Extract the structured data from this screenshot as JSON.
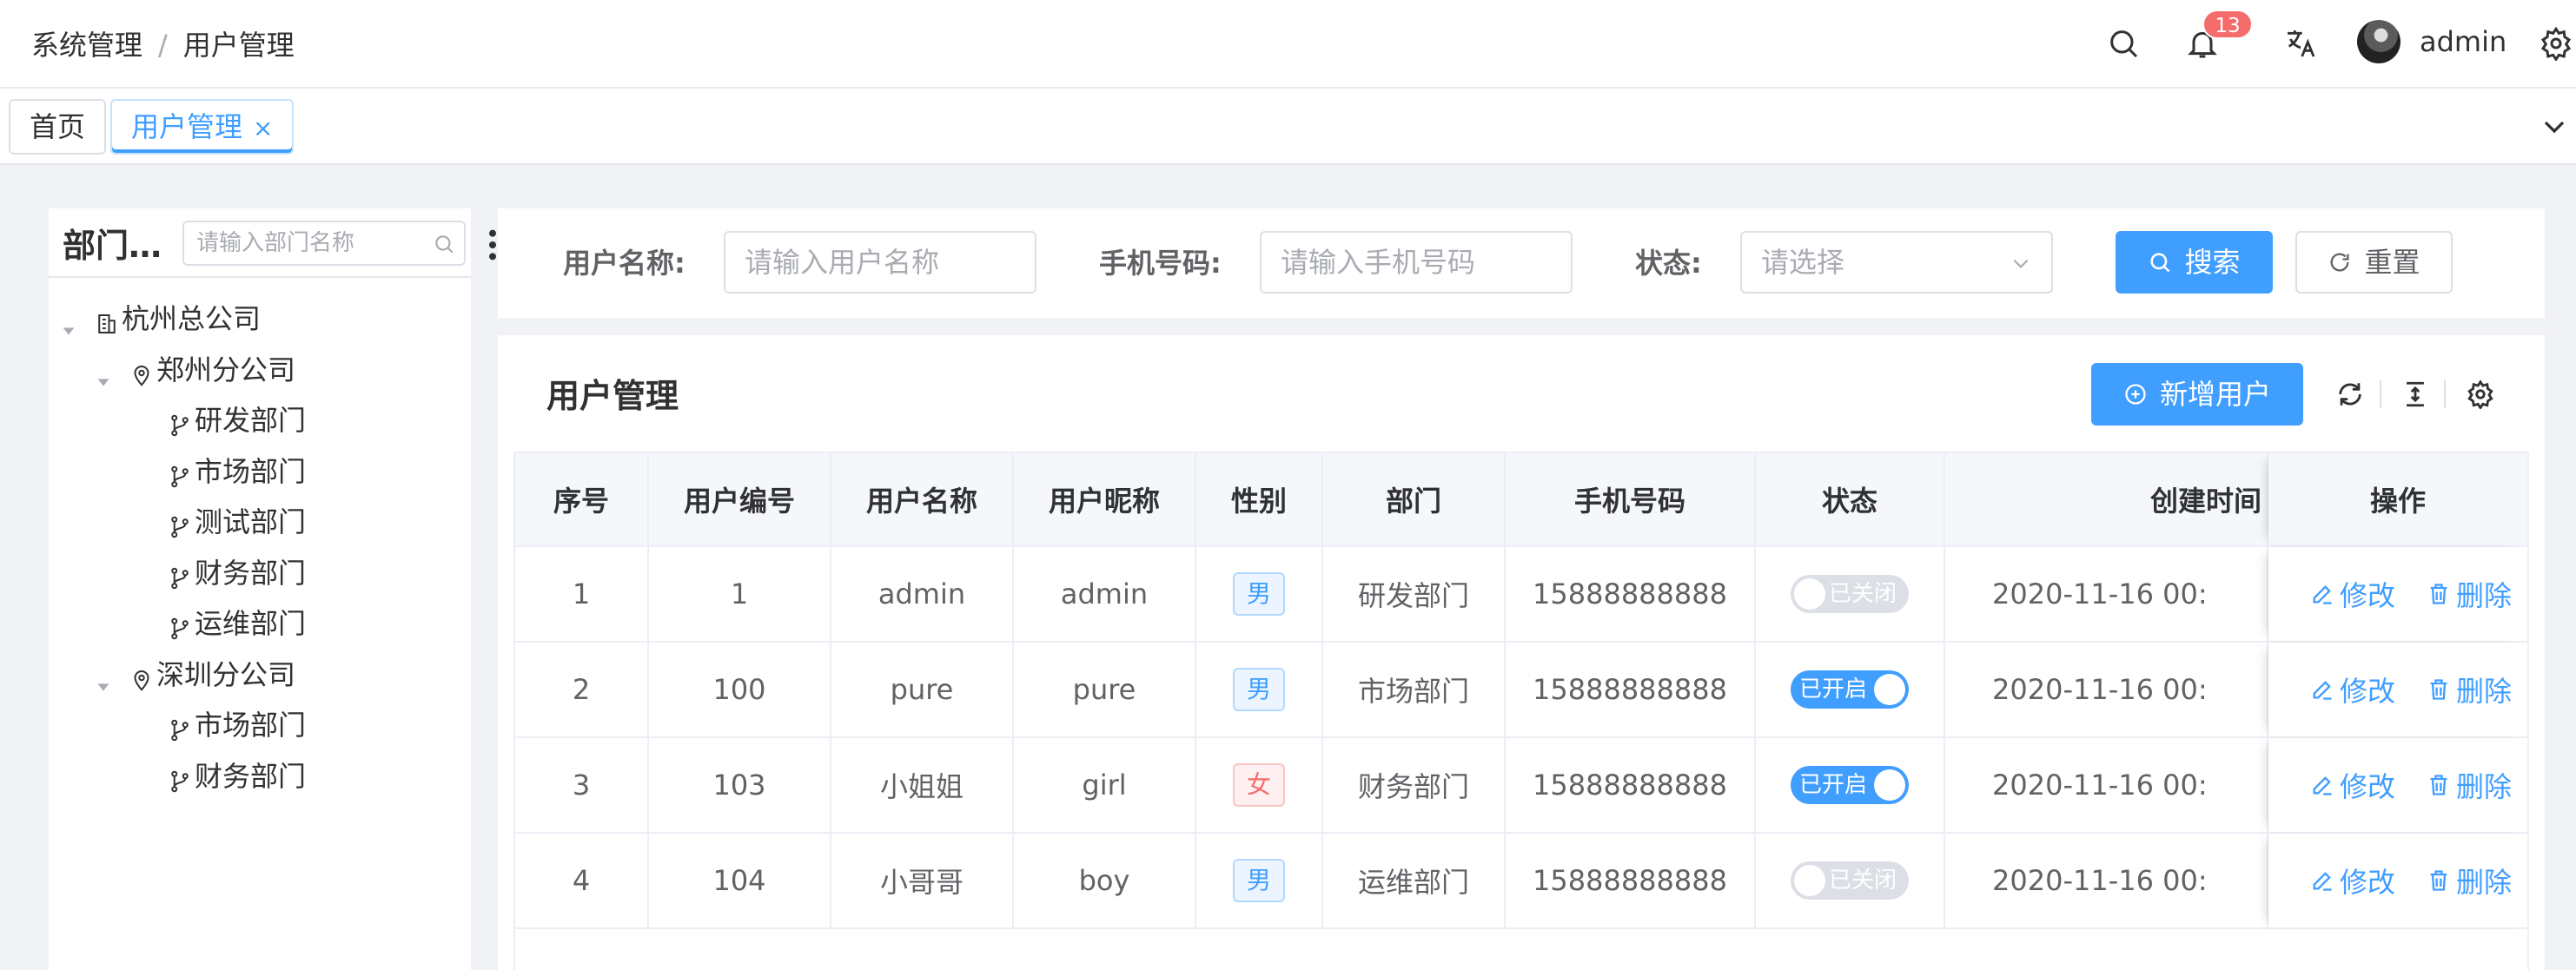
{
  "breadcrumb": {
    "items": [
      "系统管理",
      "用户管理"
    ],
    "separator": "/"
  },
  "header": {
    "notification_count": "13",
    "username": "admin"
  },
  "tabs": [
    {
      "label": "首页",
      "active": false
    },
    {
      "label": "用户管理",
      "active": true,
      "close": "×"
    }
  ],
  "dept": {
    "title": "部门…",
    "search_placeholder": "请输入部门名称",
    "tree": [
      {
        "label": "杭州总公司",
        "level": 0,
        "icon": "bank-icon",
        "expanded": true
      },
      {
        "label": "郑州分公司",
        "level": 1,
        "icon": "location-icon",
        "expanded": true
      },
      {
        "label": "研发部门",
        "level": 2,
        "icon": "branch-icon"
      },
      {
        "label": "市场部门",
        "level": 2,
        "icon": "branch-icon"
      },
      {
        "label": "测试部门",
        "level": 2,
        "icon": "branch-icon"
      },
      {
        "label": "财务部门",
        "level": 2,
        "icon": "branch-icon"
      },
      {
        "label": "运维部门",
        "level": 2,
        "icon": "branch-icon"
      },
      {
        "label": "深圳分公司",
        "level": 1,
        "icon": "location-icon",
        "expanded": true
      },
      {
        "label": "市场部门",
        "level": 2,
        "icon": "branch-icon"
      },
      {
        "label": "财务部门",
        "level": 2,
        "icon": "branch-icon"
      }
    ]
  },
  "search": {
    "username_label": "用户名称:",
    "username_placeholder": "请输入用户名称",
    "phone_label": "手机号码:",
    "phone_placeholder": "请输入手机号码",
    "status_label": "状态:",
    "status_placeholder": "请选择",
    "search_button": "搜索",
    "reset_button": "重置"
  },
  "table": {
    "title": "用户管理",
    "add_button": "新增用户",
    "columns": [
      "序号",
      "用户编号",
      "用户名称",
      "用户昵称",
      "性别",
      "部门",
      "手机号码",
      "状态",
      "创建时间",
      "操作"
    ],
    "rows": [
      {
        "index": "1",
        "id": "1",
        "username": "admin",
        "nickname": "admin",
        "gender": "男",
        "gender_type": "male",
        "dept": "研发部门",
        "phone": "15888888888",
        "status": "已关闭",
        "status_on": false,
        "created": "2020-11-16 00:",
        "edit": "修改",
        "delete": "删除"
      },
      {
        "index": "2",
        "id": "100",
        "username": "pure",
        "nickname": "pure",
        "gender": "男",
        "gender_type": "male",
        "dept": "市场部门",
        "phone": "15888888888",
        "status": "已开启",
        "status_on": true,
        "created": "2020-11-16 00:",
        "edit": "修改",
        "delete": "删除"
      },
      {
        "index": "3",
        "id": "103",
        "username": "小姐姐",
        "nickname": "girl",
        "gender": "女",
        "gender_type": "female",
        "dept": "财务部门",
        "phone": "15888888888",
        "status": "已开启",
        "status_on": true,
        "created": "2020-11-16 00:",
        "edit": "修改",
        "delete": "删除"
      },
      {
        "index": "4",
        "id": "104",
        "username": "小哥哥",
        "nickname": "boy",
        "gender": "男",
        "gender_type": "male",
        "dept": "运维部门",
        "phone": "15888888888",
        "status": "已关闭",
        "status_on": false,
        "created": "2020-11-16 00:",
        "edit": "修改",
        "delete": "删除"
      }
    ]
  },
  "colors": {
    "primary": "#409eff",
    "danger": "#f56c6c",
    "border": "#ebeef5",
    "page_bg": "#f0f2f5"
  }
}
